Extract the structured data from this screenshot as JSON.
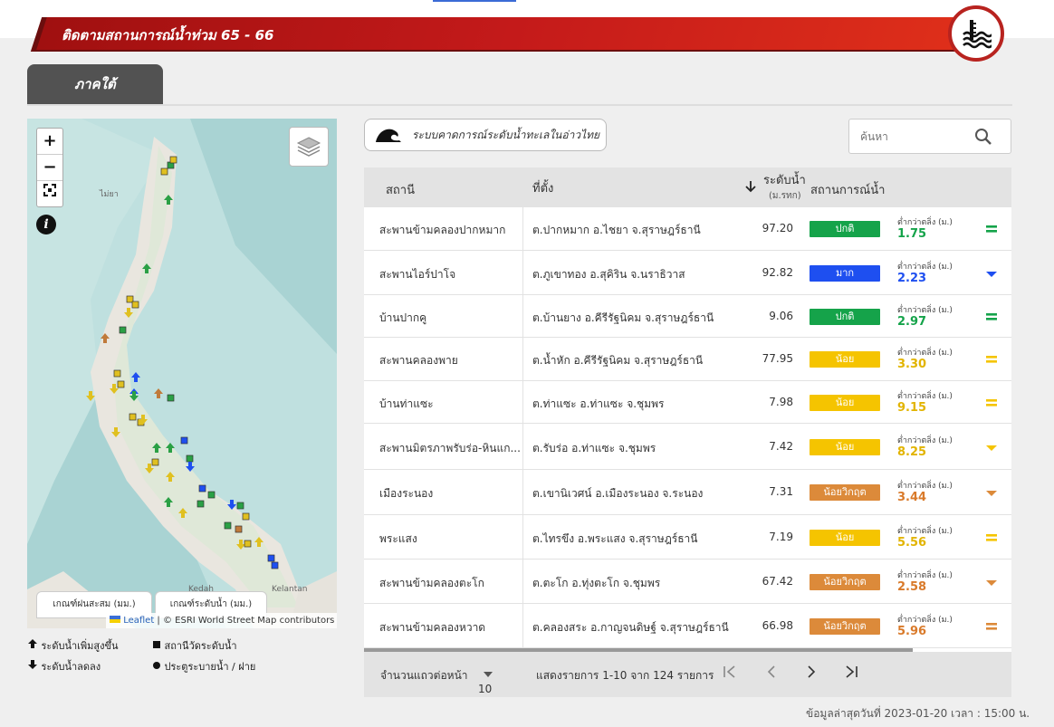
{
  "banner": {
    "title": "ติดตามสถานการณ์น้ำท่วม 65 - 66"
  },
  "region_tab": "ภาคใต้",
  "map": {
    "zoom_in": "+",
    "zoom_out": "−",
    "info": "i",
    "tab_rain": "เกณฑ์ฝนสะสม (มม.)",
    "tab_water": "เกณฑ์ระดับน้ำ (มม.)",
    "attribution_leaflet": "Leaflet",
    "attribution_rest": " | © ESRI World Street Map contributors"
  },
  "legend": {
    "rising": "ระดับน้ำเพิ่มสูงขึ้น",
    "falling": "ระดับน้ำลดลง",
    "station": "สถานีวัดระดับน้ำ",
    "gate": "ประตูระบายน้ำ / ฝาย"
  },
  "forecast_button": "ระบบคาดการณ์ระดับน้ำทะเลในอ่าวไทย",
  "search": {
    "placeholder": "ค้นหา"
  },
  "table": {
    "headers": {
      "station": "สถานี",
      "location": "ที่ตั้ง",
      "level": "ระดับน้ำ",
      "level_unit": "(ม.รทก)",
      "status": "สถานการณ์น้ำ"
    },
    "rows": [
      {
        "station": "สะพานข้ามคลองปากหมาก",
        "location": "ต.ปากหมาก อ.ไชยา จ.สุราษฎร์ธานี",
        "level": "97.20",
        "status": "ปกติ",
        "status_color": "#15a34a",
        "sub": "ต่ำกว่าตลิ่ง (ม.)",
        "diff": "1.75",
        "diff_color": "#15a34a",
        "trend": "equal",
        "trend_color": "#15a34a"
      },
      {
        "station": "สะพานไอร์ปาโจ",
        "location": "ต.ภูเขาทอง อ.สุคิริน จ.นราธิวาส",
        "level": "92.82",
        "status": "มาก",
        "status_color": "#1e4ff0",
        "sub": "ต่ำกว่าตลิ่ง (ม.)",
        "diff": "2.23",
        "diff_color": "#1e4ff0",
        "trend": "down",
        "trend_color": "#1e4ff0"
      },
      {
        "station": "บ้านปากคู",
        "location": "ต.บ้านยาง อ.คีรีรัฐนิคม จ.สุราษฎร์ธานี",
        "level": "9.06",
        "status": "ปกติ",
        "status_color": "#15a34a",
        "sub": "ต่ำกว่าตลิ่ง (ม.)",
        "diff": "2.97",
        "diff_color": "#15a34a",
        "trend": "equal",
        "trend_color": "#15a34a"
      },
      {
        "station": "สะพานคลองพาย",
        "location": "ต.น้ำหัก อ.คีรีรัฐนิคม จ.สุราษฎร์ธานี",
        "level": "77.95",
        "status": "น้อย",
        "status_color": "#f5c400",
        "sub": "ต่ำกว่าตลิ่ง (ม.)",
        "diff": "3.30",
        "diff_color": "#e2b400",
        "trend": "equal",
        "trend_color": "#f5c400"
      },
      {
        "station": "บ้านท่าแซะ",
        "location": "ต.ท่าแซะ อ.ท่าแซะ จ.ชุมพร",
        "level": "7.98",
        "status": "น้อย",
        "status_color": "#f5c400",
        "sub": "ต่ำกว่าตลิ่ง (ม.)",
        "diff": "9.15",
        "diff_color": "#e2b400",
        "trend": "equal",
        "trend_color": "#f5c400"
      },
      {
        "station": "สะพานมิตรภาพรับร่อ-หินแก...",
        "location": "ต.รับร่อ อ.ท่าแซะ จ.ชุมพร",
        "level": "7.42",
        "status": "น้อย",
        "status_color": "#f5c400",
        "sub": "ต่ำกว่าตลิ่ง (ม.)",
        "diff": "8.25",
        "diff_color": "#e2b400",
        "trend": "down",
        "trend_color": "#f5c400"
      },
      {
        "station": "เมืองระนอง",
        "location": "ต.เขานิเวศน์ อ.เมืองระนอง จ.ระนอง",
        "level": "7.31",
        "status": "น้อยวิกฤต",
        "status_color": "#dc8a3a",
        "sub": "ต่ำกว่าตลิ่ง (ม.)",
        "diff": "3.44",
        "diff_color": "#d97a2a",
        "trend": "down",
        "trend_color": "#dc8a3a"
      },
      {
        "station": "พระแสง",
        "location": "ต.ไทรขึง อ.พระแสง จ.สุราษฎร์ธานี",
        "level": "7.19",
        "status": "น้อย",
        "status_color": "#f5c400",
        "sub": "ต่ำกว่าตลิ่ง (ม.)",
        "diff": "5.56",
        "diff_color": "#e2b400",
        "trend": "equal",
        "trend_color": "#f5c400"
      },
      {
        "station": "สะพานข้ามคลองตะโก",
        "location": "ต.ตะโก อ.ทุ่งตะโก จ.ชุมพร",
        "level": "67.42",
        "status": "น้อยวิกฤต",
        "status_color": "#dc8a3a",
        "sub": "ต่ำกว่าตลิ่ง (ม.)",
        "diff": "2.58",
        "diff_color": "#d97a2a",
        "trend": "down",
        "trend_color": "#dc8a3a"
      },
      {
        "station": "สะพานข้ามคลองหวาด",
        "location": "ต.คลองสระ อ.กาญจนดิษฐ์ จ.สุราษฎร์ธานี",
        "level": "66.98",
        "status": "น้อยวิกฤต",
        "status_color": "#dc8a3a",
        "sub": "ต่ำกว่าตลิ่ง (ม.)",
        "diff": "5.96",
        "diff_color": "#d97a2a",
        "trend": "equal",
        "trend_color": "#dc8a3a"
      }
    ],
    "footer": {
      "rows_per_page_label": "จำนวนแถวต่อหน้า",
      "rows_per_page": "10",
      "range": "แสดงรายการ 1-10 จาก 124 รายการ"
    }
  },
  "updated": "ข้อมูลล่าสุดวันที่ 2023-01-20 เวลา : 15:00 น."
}
